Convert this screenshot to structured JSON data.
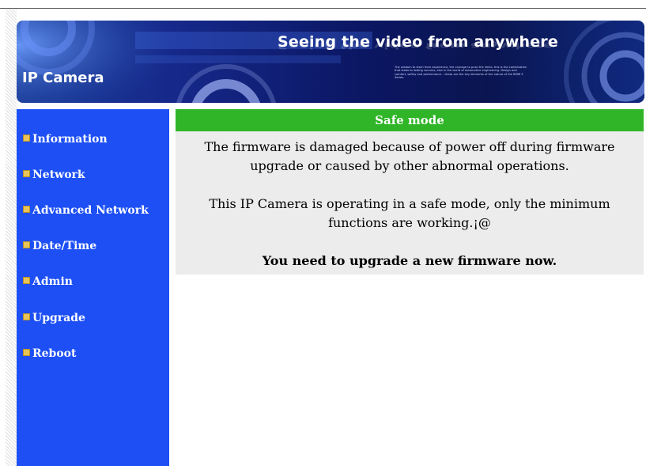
{
  "banner": {
    "title": "Seeing the video from anywhere",
    "reflection": "Seeing the video from anywhere",
    "brand": "IP Camera",
    "small_text": "The wisdom to learn from experience, the courage to push the limits. this is the combination that leads to lasting success, also in the world of automotive engineering. Design and comfort, safety and performance – these are the key elements of the nature of the BMW 5 Series."
  },
  "sidebar": {
    "items": [
      {
        "label": "Information"
      },
      {
        "label": "Network"
      },
      {
        "label": "Advanced Network"
      },
      {
        "label": "Date/Time"
      },
      {
        "label": "Admin"
      },
      {
        "label": "Upgrade"
      },
      {
        "label": "Reboot"
      }
    ]
  },
  "main": {
    "header": "Safe mode",
    "message_1_line_1": "The firmware is damaged because of power off during firmware",
    "message_1_line_2": "upgrade or caused by other abnormal operations.",
    "message_2_line_1": "This IP Camera is operating in a safe mode, only the minimum",
    "message_2_line_2": "functions are working.¡@",
    "message_3": "You need to upgrade a new firmware now."
  },
  "colors": {
    "sidebar_bg": "#1d4ff5",
    "header_green": "#2fb527",
    "content_bg": "#ececec",
    "banner_dark": "#0b1763"
  }
}
